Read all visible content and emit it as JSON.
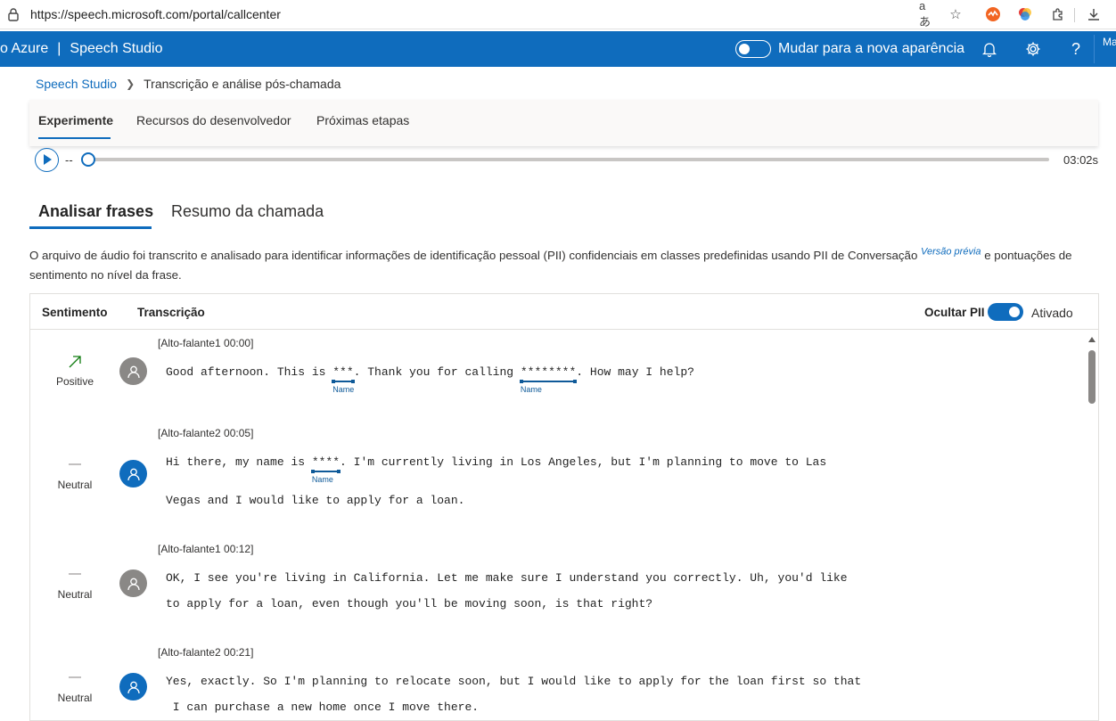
{
  "browser": {
    "url": "https://speech.microsoft.com/portal/callcenter"
  },
  "header": {
    "brand_left": "o Azure",
    "brand_sep": "|",
    "brand_right": "Speech Studio",
    "new_look_label": "Mudar para a nova aparência",
    "cut_text": "Ma"
  },
  "breadcrumb": {
    "root": "Speech Studio",
    "current": "Transcrição e análise pós-chamada"
  },
  "top_tabs": [
    {
      "label": "Experimente",
      "active": true
    },
    {
      "label": "Recursos do desenvolvedor",
      "active": false
    },
    {
      "label": "Próximas etapas",
      "active": false
    }
  ],
  "player": {
    "current_time": "--",
    "duration": "03:02s",
    "progress": 0
  },
  "analysis_tabs": [
    {
      "label": "Analisar frases",
      "active": true
    },
    {
      "label": "Resumo da chamada",
      "active": false
    }
  ],
  "description": {
    "text_before": "O arquivo de áudio foi transcrito e analisado para identificar informações de identificação pessoal (PII) confidenciais em classes predefinidas usando PII de Conversação ",
    "preview_badge": "Versão prévia",
    "text_after": " e pontuações de sentimento no nível da frase."
  },
  "table": {
    "col_sentiment": "Sentimento",
    "col_transcription": "Transcrição",
    "hide_pii_label": "Ocultar PII",
    "hide_pii_state": "Ativado",
    "hide_pii_on": true
  },
  "transcript": [
    {
      "speaker": "[Alto-falante1 00:00]",
      "sentiment": "Positive",
      "avatar": "gray",
      "l1_a": "Good afternoon. This is ",
      "l1_pii1": "***",
      "l1_b": ". Thank you for calling ",
      "l1_pii2": "********",
      "l1_c": ". How may I help?",
      "pii_tag": "Name"
    },
    {
      "speaker": "[Alto-falante2 00:05]",
      "sentiment": "Neutral",
      "avatar": "blue",
      "l1_a": "Hi there, my name is ",
      "l1_pii1": "****",
      "l1_b": ". I'm currently living in Los Angeles, but I'm planning to move to Las",
      "l2": "Vegas and I would like to apply for a loan.",
      "pii_tag": "Name"
    },
    {
      "speaker": "[Alto-falante1 00:12]",
      "sentiment": "Neutral",
      "avatar": "gray",
      "l1": "OK, I see you're living in California. Let me make sure I understand you correctly. Uh, you'd like",
      "l2": "to apply for a loan, even though you'll be moving soon, is that right?"
    },
    {
      "speaker": "[Alto-falante2 00:21]",
      "sentiment": "Neutral",
      "avatar": "blue",
      "l1": "Yes, exactly. So I'm planning to relocate soon, but I would like to apply for the loan first so that",
      "l2": " I can purchase a new home once I move there."
    }
  ]
}
